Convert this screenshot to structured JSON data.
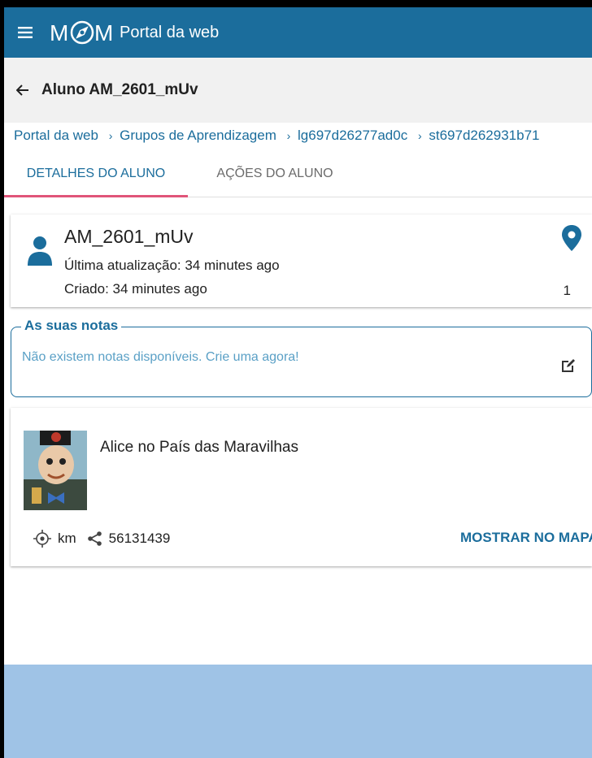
{
  "app": {
    "logo_text": "Portal da web",
    "brand_color": "#1b6d9c"
  },
  "titlebar": {
    "title": "Aluno AM_2601_mUv"
  },
  "breadcrumb": [
    {
      "label": "Portal da web"
    },
    {
      "label": "Grupos de Aprendizagem"
    },
    {
      "label": "lg697d26277ad0c"
    },
    {
      "label": "st697d262931b71"
    }
  ],
  "tabs": [
    {
      "label": "DETALHES DO ALUNO",
      "active": true
    },
    {
      "label": "AÇÕES DO ALUNO",
      "active": false
    }
  ],
  "student": {
    "name": "AM_2601_mUv",
    "updated": "Última atualização: 34 minutes ago",
    "created": "Criado: 34 minutes ago",
    "pin_count": "1"
  },
  "notes": {
    "legend": "As suas notas",
    "empty_text": "Não existem notas disponíveis. Crie uma agora!"
  },
  "book": {
    "title": "Alice no País das Maravilhas",
    "distance_unit": "km",
    "share_id": "56131439",
    "map_button": "MOSTRAR NO MAPA"
  },
  "icons": {
    "menu": "menu-icon",
    "back": "arrow-left-icon",
    "avatar": "person-icon",
    "pin": "map-pin-icon",
    "edit": "edit-icon",
    "location": "gps-target-icon",
    "share": "share-icon"
  }
}
